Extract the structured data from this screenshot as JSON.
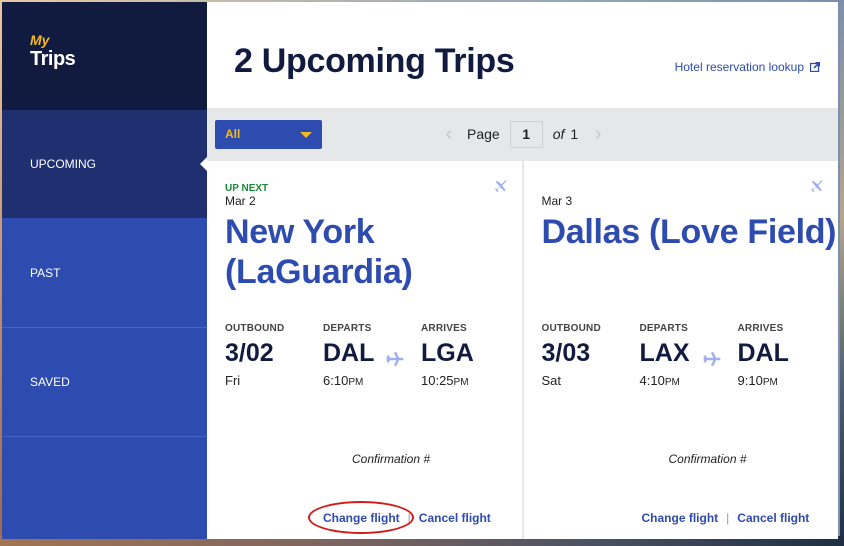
{
  "brand": {
    "my": "My",
    "trips": "Trips"
  },
  "sidebar": {
    "items": [
      {
        "label": "UPCOMING",
        "active": true
      },
      {
        "label": "PAST",
        "active": false
      },
      {
        "label": "SAVED",
        "active": false
      }
    ]
  },
  "header": {
    "title": "2 Upcoming Trips",
    "hotel_link": "Hotel reservation lookup",
    "hotel_link_icon": "external-link-icon"
  },
  "toolbar": {
    "filter": {
      "selected": "All"
    },
    "pager": {
      "label": "Page",
      "current": "1",
      "of_label": "of",
      "total": "1"
    }
  },
  "trips": [
    {
      "badge": "UP NEXT",
      "date": "Mar 2",
      "destination": "New York (LaGuardia)",
      "icon": "plane-icon",
      "outbound_label": "OUTBOUND",
      "outbound_date": "3/02",
      "outbound_day": "Fri",
      "departs_label": "DEPARTS",
      "departs_code": "DAL",
      "departs_time": "6:10",
      "departs_ampm": "PM",
      "arrives_label": "ARRIVES",
      "arrives_code": "LGA",
      "arrives_time": "10:25",
      "arrives_ampm": "PM",
      "confirmation_label": "Confirmation #",
      "change_label": "Change flight",
      "separator": "|",
      "cancel_label": "Cancel flight",
      "change_highlighted": true
    },
    {
      "badge": "",
      "date": "Mar 3",
      "destination": "Dallas (Love Field)",
      "icon": "plane-icon",
      "outbound_label": "OUTBOUND",
      "outbound_date": "3/03",
      "outbound_day": "Sat",
      "departs_label": "DEPARTS",
      "departs_code": "LAX",
      "departs_time": "4:10",
      "departs_ampm": "PM",
      "arrives_label": "ARRIVES",
      "arrives_code": "DAL",
      "arrives_time": "9:10",
      "arrives_ampm": "PM",
      "confirmation_label": "Confirmation #",
      "change_label": "Change flight",
      "separator": "|",
      "cancel_label": "Cancel flight",
      "change_highlighted": false
    }
  ],
  "colors": {
    "brand_navy": "#111b40",
    "brand_blue": "#2e4bb0",
    "accent_gold": "#f5b920",
    "up_next_green": "#1a8a3a",
    "highlight_red": "#d01c1c"
  }
}
